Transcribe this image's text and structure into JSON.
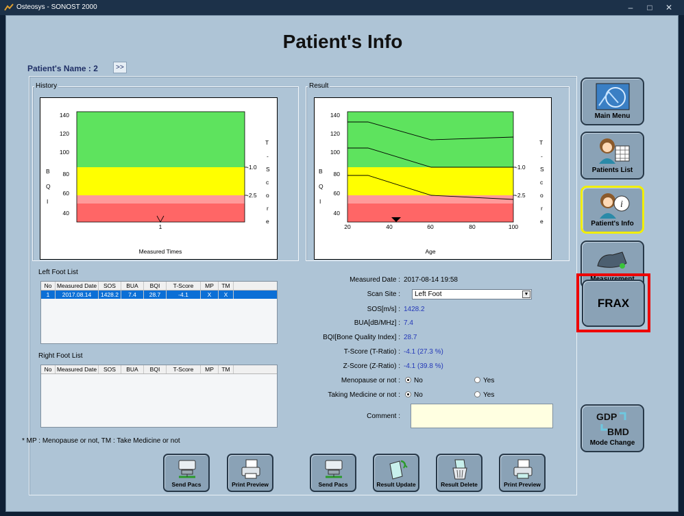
{
  "window": {
    "title": "Osteosys - SONOST 2000",
    "minimize": "–",
    "maximize": "□",
    "close": "✕"
  },
  "page_title": "Patient's Info",
  "patient": {
    "name_label": "Patient's Name : 2",
    "expand_label": ">>"
  },
  "history": {
    "group_label": "History",
    "chart": {
      "left_axis_letters": [
        "B",
        "Q",
        "I"
      ],
      "right_axis_letters": [
        "T",
        "-",
        "S",
        "c",
        "o",
        "r",
        "e"
      ],
      "y_ticks": [
        "140",
        "120",
        "100",
        "80",
        "60",
        "40"
      ],
      "t_score_marks": [
        "-1.0",
        "-2.5"
      ],
      "x_tick": "1",
      "xlabel": "Measured Times",
      "zone_colors": {
        "normal": "#5ee35e",
        "osteopenia": "#ffff00",
        "low": "#ff9a9a",
        "osteoporosis": "#ff6666"
      }
    }
  },
  "result": {
    "group_label": "Result",
    "chart": {
      "left_axis_letters": [
        "B",
        "Q",
        "I"
      ],
      "right_axis_letters": [
        "T",
        "-",
        "S",
        "c",
        "o",
        "r",
        "e"
      ],
      "y_ticks": [
        "140",
        "120",
        "100",
        "80",
        "60",
        "40"
      ],
      "t_score_marks": [
        "-1.0",
        "-2.5"
      ],
      "x_ticks": [
        "20",
        "40",
        "60",
        "80",
        "100"
      ],
      "xlabel": "Age"
    }
  },
  "left_foot": {
    "label": "Left Foot List",
    "columns": [
      "No",
      "Measured Date",
      "SOS",
      "BUA",
      "BQI",
      "T-Score",
      "MP",
      "TM"
    ],
    "rows": [
      [
        "1",
        "2017.08.14",
        "1428.2",
        "7.4",
        "28.7",
        "-4.1",
        "X",
        "X"
      ]
    ]
  },
  "right_foot": {
    "label": "Right Foot List",
    "columns": [
      "No",
      "Measured Date",
      "SOS",
      "BUA",
      "BQI",
      "T-Score",
      "MP",
      "TM"
    ]
  },
  "footnote": "* MP : Menopause or not, TM : Take Medicine or not",
  "details": {
    "measured_date_label": "Measured Date :",
    "measured_date": "2017-08-14 19:58",
    "scan_site_label": "Scan Site :",
    "scan_site": "Left Foot",
    "sos_label": "SOS[m/s] :",
    "sos": "1428.2",
    "bua_label": "BUA[dB/MHz] :",
    "bua": "7.4",
    "bqi_label": "BQI[Bone Quality Index] :",
    "bqi": "28.7",
    "t_score_label": "T-Score (T-Ratio) :",
    "t_score": "-4.1 (27.3 %)",
    "z_score_label": "Z-Score (Z-Ratio) :",
    "z_score": "-4.1 (39.8 %)",
    "menopause_label": "Menopause or not :",
    "medicine_label": "Taking Medicine or not :",
    "no_label": "No",
    "yes_label": "Yes",
    "comment_label": "Comment :",
    "comment_value": ""
  },
  "buttons": {
    "send_pacs": "Send Pacs",
    "print_preview": "Print Preview",
    "result_update": "Result Update",
    "result_delete": "Result Delete"
  },
  "nav": {
    "main_menu": "Main Menu",
    "patients_list": "Patients List",
    "patients_info": "Patient's Info",
    "measurement": "Measurement",
    "frax": "FRAX",
    "mode_change": "Mode Change",
    "gdp": "GDP",
    "bmd": "BMD"
  }
}
